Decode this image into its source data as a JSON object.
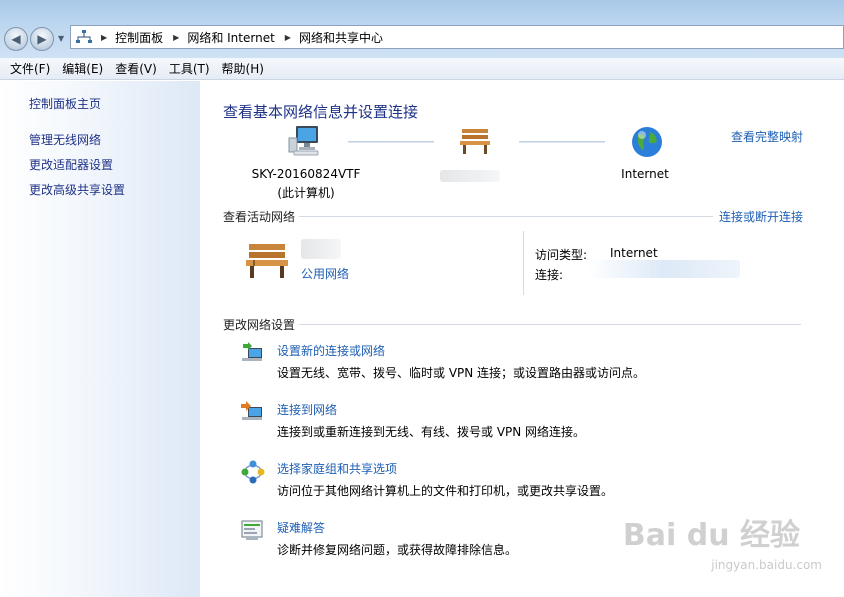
{
  "breadcrumb": [
    "控制面板",
    "网络和 Internet",
    "网络和共享中心"
  ],
  "menu": [
    "文件(F)",
    "编辑(E)",
    "查看(V)",
    "工具(T)",
    "帮助(H)"
  ],
  "sidebar": {
    "home": "控制面板主页",
    "items": [
      "管理无线网络",
      "更改适配器设置",
      "更改高级共享设置"
    ]
  },
  "main": {
    "title": "查看基本网络信息并设置连接",
    "full_map_link": "查看完整映射",
    "computer_name": "SKY-20160824VTF",
    "computer_sub": "(此计算机)",
    "internet_label": "Internet",
    "active_networks_heading": "查看活动网络",
    "connect_disconnect_link": "连接或断开连接",
    "network_type_link": "公用网络",
    "access_type_label": "访问类型:",
    "access_type_value": "Internet",
    "connection_label": "连接:",
    "change_settings_heading": "更改网络设置",
    "tasks": [
      {
        "link": "设置新的连接或网络",
        "desc": "设置无线、宽带、拨号、临时或 VPN 连接；或设置路由器或访问点。",
        "icon": "new-connection-icon"
      },
      {
        "link": "连接到网络",
        "desc": "连接到或重新连接到无线、有线、拨号或 VPN 网络连接。",
        "icon": "connect-network-icon"
      },
      {
        "link": "选择家庭组和共享选项",
        "desc": "访问位于其他网络计算机上的文件和打印机，或更改共享设置。",
        "icon": "homegroup-icon"
      },
      {
        "link": "疑难解答",
        "desc": "诊断并修复网络问题，或获得故障排除信息。",
        "icon": "troubleshoot-icon"
      }
    ]
  },
  "watermark": {
    "main": "Bai du 经验",
    "sub": "jingyan.baidu.com"
  },
  "colors": {
    "link": "#1e5fb4",
    "title": "#1e3287",
    "sidebar_gradient_end": "#dde8f6"
  }
}
